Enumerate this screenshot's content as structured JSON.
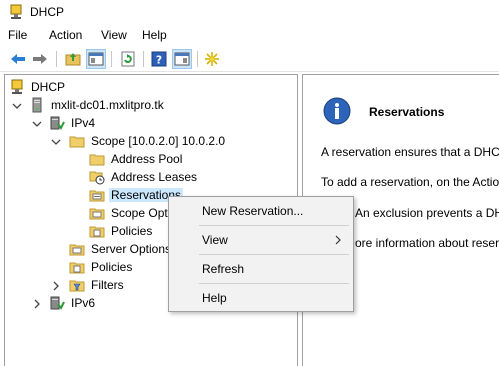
{
  "window": {
    "title": "DHCP",
    "icon": "dhcp-app-icon"
  },
  "menubar": {
    "items": [
      "File",
      "Action",
      "View",
      "Help"
    ]
  },
  "toolbar": {
    "buttons": [
      {
        "name": "back-icon"
      },
      {
        "name": "forward-icon"
      },
      {
        "name": "up-folder-icon"
      },
      {
        "name": "show-hide-console-tree-icon"
      },
      {
        "name": "refresh-icon"
      },
      {
        "name": "help-icon"
      },
      {
        "name": "show-hide-action-pane-icon"
      },
      {
        "name": "star-burst-icon"
      }
    ]
  },
  "tree": {
    "items": [
      {
        "label": "DHCP",
        "icon": "dhcp-icon"
      },
      {
        "label": "mxlit-dc01.mxlitpro.tk",
        "icon": "server-icon",
        "expander": "expanded"
      },
      {
        "label": "IPv4",
        "icon": "ipv4-icon",
        "expander": "expanded"
      },
      {
        "label": "Scope [10.0.2.0] 10.0.2.0",
        "icon": "folder-icon",
        "expander": "expanded"
      },
      {
        "label": "Address Pool",
        "icon": "folder-icon"
      },
      {
        "label": "Address Leases",
        "icon": "leases-icon"
      },
      {
        "label": "Reservations",
        "icon": "reservations-icon",
        "selected": true
      },
      {
        "label": "Scope Opti",
        "icon": "scope-options-icon"
      },
      {
        "label": "Policies",
        "icon": "folder-icon"
      },
      {
        "label": "Server Options",
        "icon": "server-options-icon"
      },
      {
        "label": "Policies",
        "icon": "folder-icon"
      },
      {
        "label": "Filters",
        "icon": "filter-icon",
        "expander": "collapsed"
      },
      {
        "label": "IPv6",
        "icon": "ipv6-icon",
        "expander": "collapsed"
      }
    ]
  },
  "right_pane": {
    "title": "Reservations",
    "icon": "info-icon",
    "lines": [
      "A reservation ensures that a DHCP",
      "To add a reservation, on the Action",
      "An exclusion prevents a DHC",
      "ore information about reserv"
    ]
  },
  "context_menu": {
    "items": [
      {
        "label": "New Reservation..."
      },
      {
        "label": "View",
        "submenu": true
      },
      {
        "label": "Refresh"
      },
      {
        "label": "Help"
      }
    ]
  },
  "colors": {
    "selection": "#cce8ff",
    "menu_bg": "#f2f2f2",
    "toolbar_pressed": "#cce4f7"
  }
}
